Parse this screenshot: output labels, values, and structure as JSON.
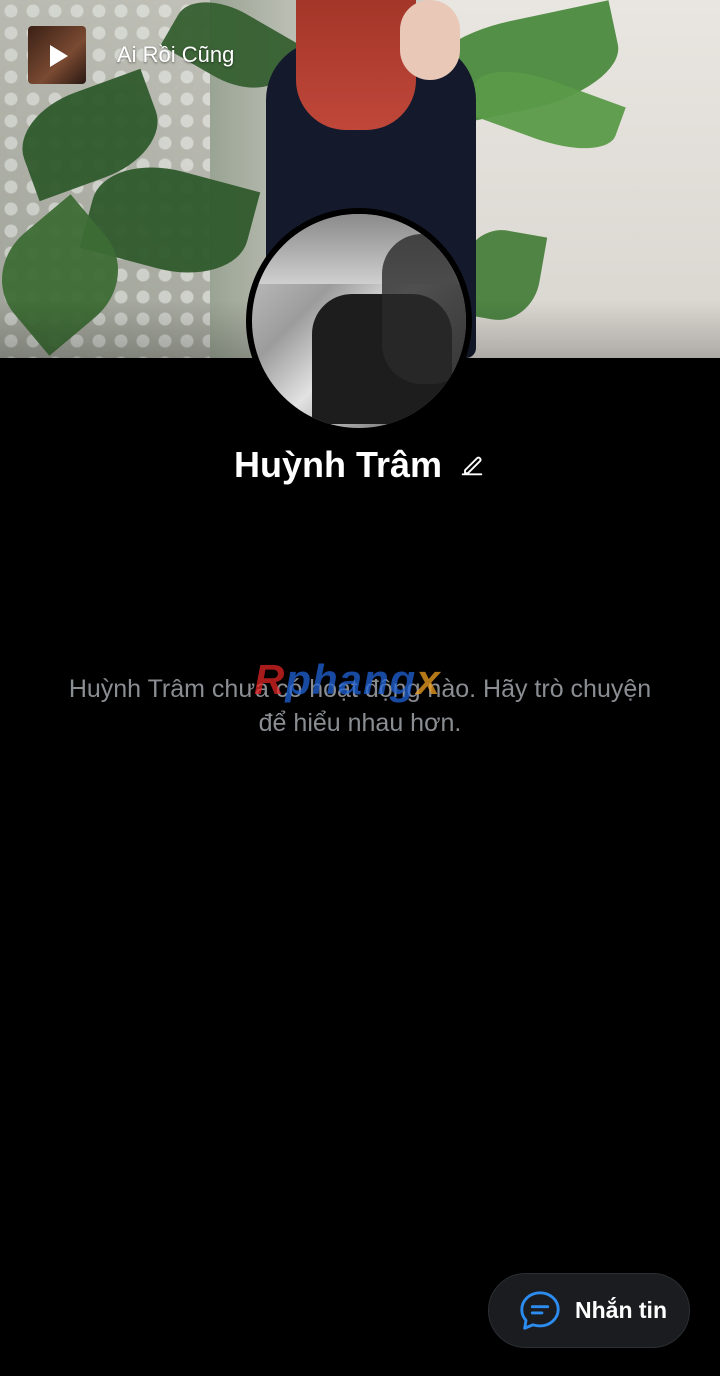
{
  "music": {
    "title": "Ai Rồi Cũng",
    "play_icon": "play-icon"
  },
  "profile": {
    "name": "Huỳnh Trâm",
    "edit_icon": "pencil-icon"
  },
  "empty_state": {
    "message": "Huỳnh Trâm chưa có hoạt động nào. Hãy trò chuyện để hiểu nhau hơn."
  },
  "watermark": {
    "part1": "R",
    "part2": "phang",
    "part3": "x"
  },
  "message_button": {
    "label": "Nhắn tin",
    "icon": "chat-bubble-icon"
  },
  "colors": {
    "background": "#000000",
    "button_bg": "#1a1c1f",
    "accent_icon": "#2d8cf0",
    "muted_text": "#8a8d92"
  }
}
